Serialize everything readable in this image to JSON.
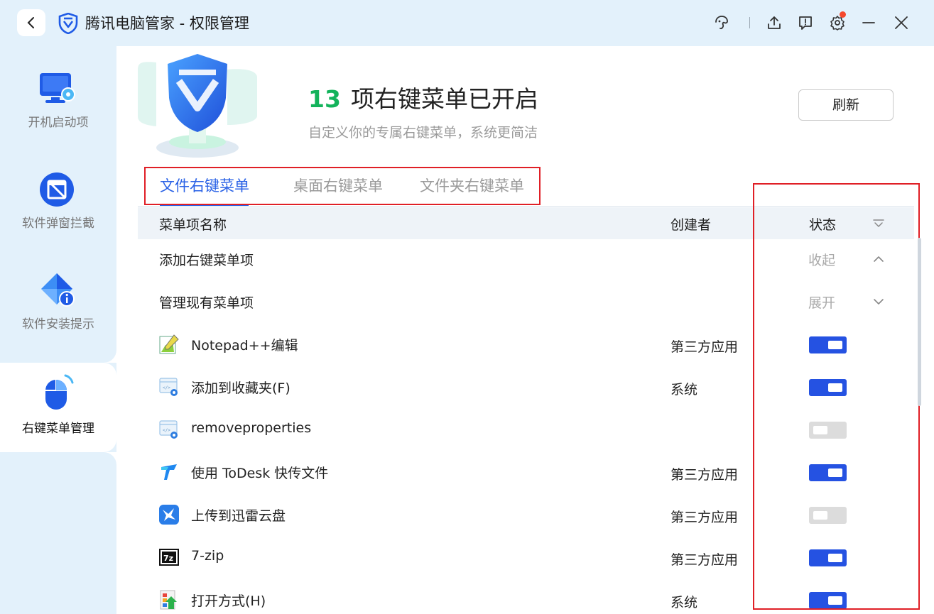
{
  "window": {
    "title": "腾讯电脑管家 - 权限管理"
  },
  "sidebar": {
    "items": [
      {
        "label": "开机启动项",
        "icon": "monitor-icon",
        "active": false
      },
      {
        "label": "软件弹窗拦截",
        "icon": "popup-block-icon",
        "active": false
      },
      {
        "label": "软件安装提示",
        "icon": "install-notice-icon",
        "active": false
      },
      {
        "label": "右键菜单管理",
        "icon": "mouse-icon",
        "active": true
      }
    ]
  },
  "header": {
    "count": "13",
    "count_text": "项右键菜单已开启",
    "subtitle": "自定义你的专属右键菜单，系统更简洁",
    "refresh_label": "刷新"
  },
  "tabs": [
    {
      "label": "文件右键菜单",
      "active": true
    },
    {
      "label": "桌面右键菜单",
      "active": false
    },
    {
      "label": "文件夹右键菜单",
      "active": false
    }
  ],
  "table": {
    "col_name": "菜单项名称",
    "col_creator": "创建者",
    "col_status": "状态",
    "groups": [
      {
        "label": "添加右键菜单项",
        "status": "收起",
        "chevron": "up"
      },
      {
        "label": "管理现有菜单项",
        "status": "展开",
        "chevron": "down"
      }
    ],
    "rows": [
      {
        "name": "Notepad++编辑",
        "creator": "第三方应用",
        "enabled": true,
        "icon": "notepad-plus-plus-icon"
      },
      {
        "name": "添加到收藏夹(F)",
        "creator": "系统",
        "enabled": true,
        "icon": "system-window-icon"
      },
      {
        "name": "removeproperties",
        "creator": "",
        "enabled": false,
        "icon": "system-window-icon"
      },
      {
        "name": "使用 ToDesk 快传文件",
        "creator": "第三方应用",
        "enabled": true,
        "icon": "todesk-icon"
      },
      {
        "name": "上传到迅雷云盘",
        "creator": "第三方应用",
        "enabled": false,
        "icon": "xunlei-icon"
      },
      {
        "name": "7-zip",
        "creator": "第三方应用",
        "enabled": true,
        "icon": "seven-zip-icon"
      },
      {
        "name": "打开方式(H)",
        "creator": "系统",
        "enabled": true,
        "icon": "open-with-icon"
      }
    ]
  },
  "colors": {
    "accent": "#2a62e6",
    "toggle_on": "#2552e2",
    "count_green": "#13b35b",
    "highlight_red": "#e01f26",
    "sidebar_bg": "#e3f1fb"
  }
}
